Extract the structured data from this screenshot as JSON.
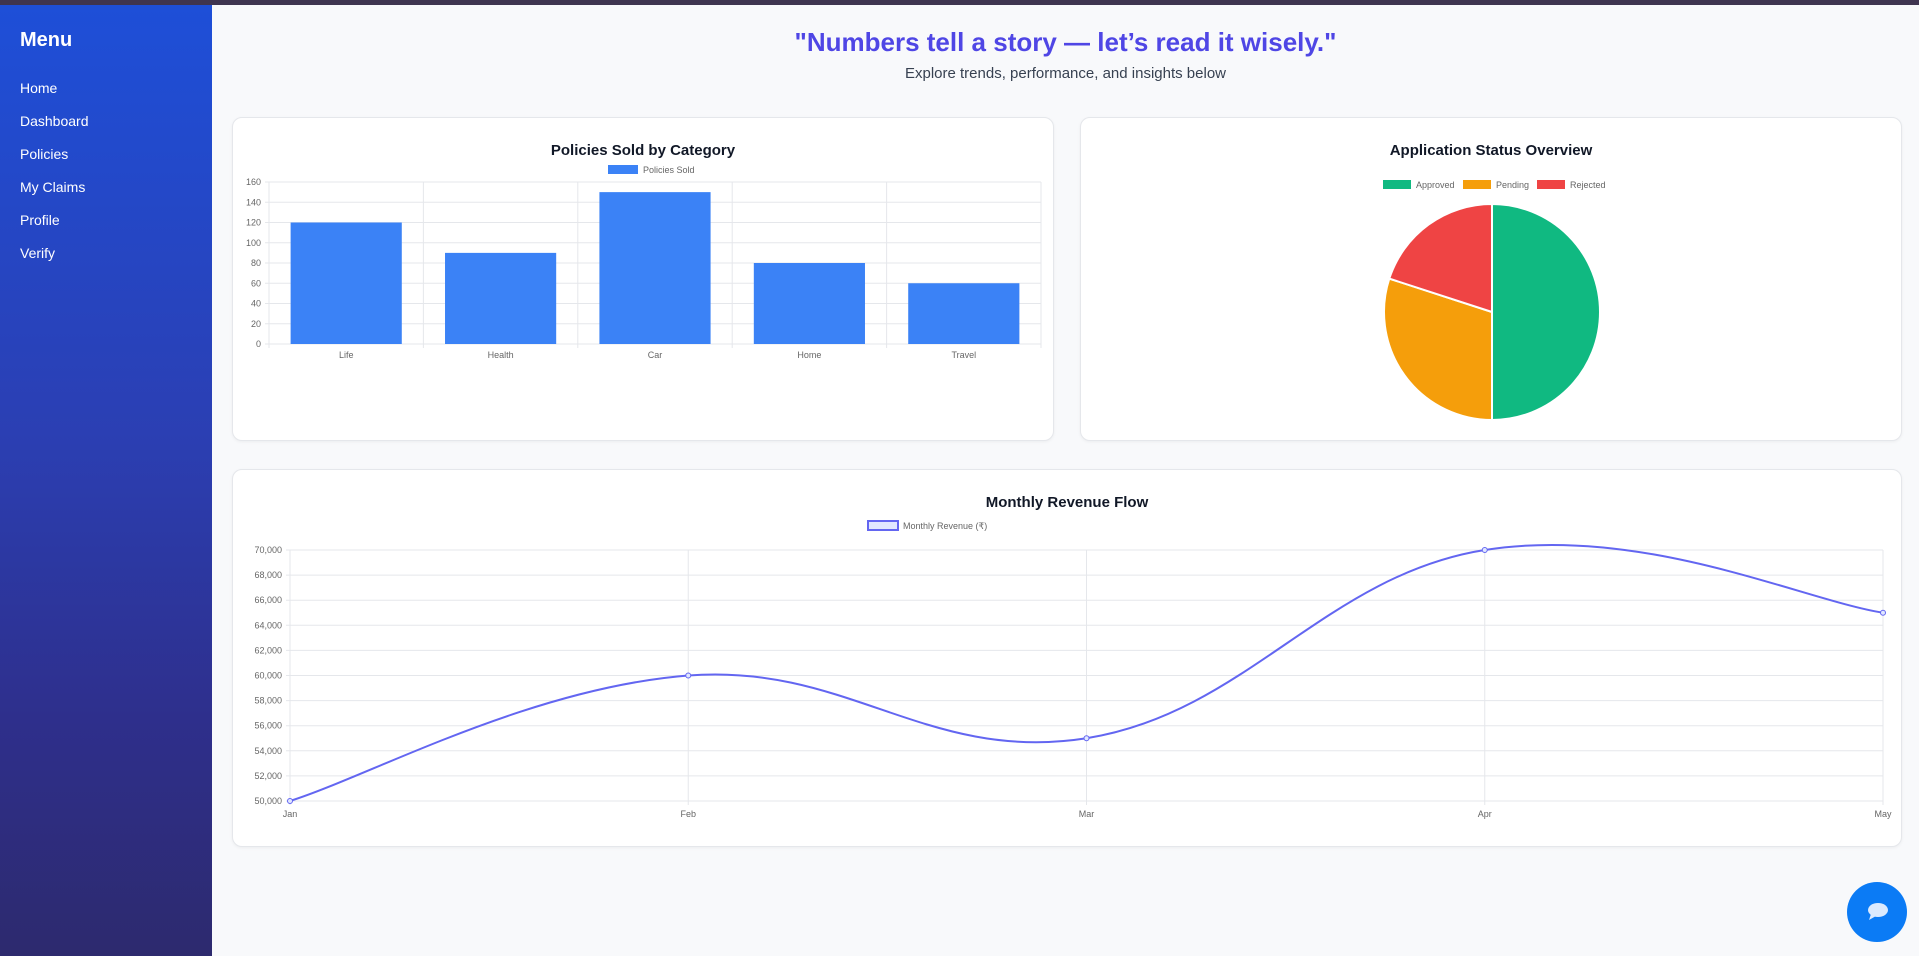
{
  "sidebar": {
    "title": "Menu",
    "items": [
      {
        "label": "Home"
      },
      {
        "label": "Dashboard"
      },
      {
        "label": "Policies"
      },
      {
        "label": "My Claims"
      },
      {
        "label": "Profile"
      },
      {
        "label": "Verify"
      }
    ]
  },
  "header": {
    "quote": "\"Numbers tell a story — let’s read it wisely.\"",
    "subtitle": "Explore trends, performance, and insights below"
  },
  "chat_button": {
    "icon": "chat-bubble-icon"
  },
  "colors": {
    "accent": "#4f46e5",
    "bar": "#3b82f6",
    "approved": "#10b981",
    "pending": "#f59e0b",
    "rejected": "#ef4444",
    "line": "#6366f1"
  },
  "chart_data": [
    {
      "type": "bar",
      "title": "Policies Sold by Category",
      "categories": [
        "Life",
        "Health",
        "Car",
        "Home",
        "Travel"
      ],
      "series": [
        {
          "name": "Policies Sold",
          "values": [
            120,
            90,
            150,
            80,
            60
          ]
        }
      ],
      "ylim": [
        0,
        160
      ],
      "yticks": [
        "0",
        "20",
        "40",
        "60",
        "80",
        "100",
        "120",
        "140",
        "160"
      ],
      "grid": true,
      "legend": "top"
    },
    {
      "type": "pie",
      "title": "Application Status Overview",
      "labels": [
        "Approved",
        "Pending",
        "Rejected"
      ],
      "values": [
        50,
        30,
        20
      ],
      "legend": "top"
    },
    {
      "type": "line",
      "title": "Monthly Revenue Flow",
      "categories": [
        "Jan",
        "Feb",
        "Mar",
        "Apr",
        "May"
      ],
      "series": [
        {
          "name": "Monthly Revenue (₹)",
          "values": [
            50000,
            60000,
            55000,
            70000,
            65000
          ]
        }
      ],
      "ylim": [
        50000,
        70000
      ],
      "yticks": [
        "50,000",
        "52,000",
        "54,000",
        "56,000",
        "58,000",
        "60,000",
        "62,000",
        "64,000",
        "66,000",
        "68,000",
        "70,000"
      ],
      "grid": true,
      "legend": "top"
    }
  ]
}
